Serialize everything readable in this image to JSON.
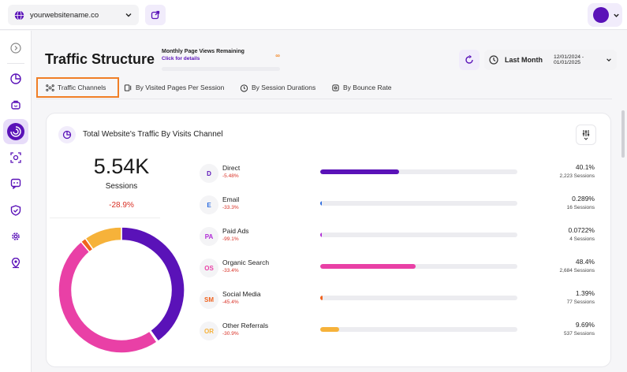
{
  "topbar": {
    "site": "yourwebsitename.co",
    "icons": {
      "site": "globe-icon",
      "external": "external-link-icon",
      "menu": "chevron-down-icon"
    }
  },
  "sidebar": {
    "items": [
      {
        "icon": "collapse-sidebar-icon"
      },
      {
        "icon": "dashboard-icon"
      },
      {
        "icon": "users-icon"
      },
      {
        "icon": "traffic-structure-icon",
        "active": true
      },
      {
        "icon": "focus-target-icon"
      },
      {
        "icon": "chat-icon"
      },
      {
        "icon": "shield-icon"
      },
      {
        "icon": "gear-icon"
      },
      {
        "icon": "location-icon"
      }
    ]
  },
  "header": {
    "title": "Traffic Structure",
    "quota_title": "Monthly Page Views Remaining",
    "quota_link": "Click for details",
    "quota_value": "∞",
    "date_label": "Last Month",
    "date_range": "12/01/2024 - 01/01/2025"
  },
  "tabs": [
    {
      "label": "Traffic Channels",
      "icon": "channels-icon",
      "active": true
    },
    {
      "label": "By Visited Pages Per Session",
      "icon": "pages-icon"
    },
    {
      "label": "By Session Durations",
      "icon": "timer-icon"
    },
    {
      "label": "By Bounce Rate",
      "icon": "bounce-icon"
    }
  ],
  "card": {
    "title": "Total Website's Traffic By Visits Channel",
    "total": "5.54K",
    "total_label": "Sessions",
    "total_delta": "-28.9%",
    "channels": [
      {
        "badge": "D",
        "name": "Direct",
        "delta": "-5.48%",
        "pct": "40.1%",
        "sessions": "2,223 Sessions",
        "share": 40.1,
        "color": "#5a12b8"
      },
      {
        "badge": "E",
        "name": "Email",
        "delta": "-33.3%",
        "pct": "0.289%",
        "sessions": "16 Sessions",
        "share": 0.289,
        "color": "#2d6cdf"
      },
      {
        "badge": "PA",
        "name": "Paid Ads",
        "delta": "-99.1%",
        "pct": "0.0722%",
        "sessions": "4 Sessions",
        "share": 0.0722,
        "color": "#b02ad6"
      },
      {
        "badge": "OS",
        "name": "Organic Search",
        "delta": "-33.4%",
        "pct": "48.4%",
        "sessions": "2,684 Sessions",
        "share": 48.4,
        "color": "#e940a6"
      },
      {
        "badge": "SM",
        "name": "Social Media",
        "delta": "-45.4%",
        "pct": "1.39%",
        "sessions": "77 Sessions",
        "share": 1.39,
        "color": "#f0621e"
      },
      {
        "badge": "OR",
        "name": "Other Referrals",
        "delta": "-30.9%",
        "pct": "9.69%",
        "sessions": "537 Sessions",
        "share": 9.69,
        "color": "#f6b23a"
      }
    ]
  }
}
